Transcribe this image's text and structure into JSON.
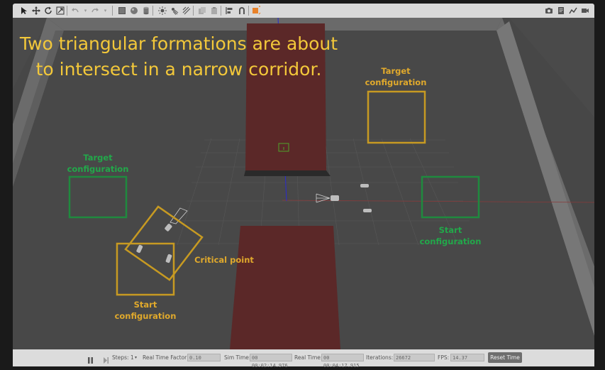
{
  "overlay": {
    "title_line1": "Two triangular formations are about",
    "title_line2": "to intersect in a narrow corridor."
  },
  "annotations": {
    "target_gold_1": "Target",
    "target_gold_2": "configuration",
    "target_green_1": "Target",
    "target_green_2": "configuration",
    "start_green_1": "Start",
    "start_green_2": "configuration",
    "start_gold_1": "Start",
    "start_gold_2": "configuration",
    "critical": "Critical point"
  },
  "colors": {
    "gold": "#e0a92c",
    "green": "#22a84a",
    "obstacle": "#5a2a2a",
    "ground": "#484848"
  },
  "toolbar": {
    "icons": [
      "select-arrow-icon",
      "translate-icon",
      "rotate-icon",
      "scale-icon",
      "undo-icon",
      "undo-dropdown-icon",
      "redo-icon",
      "redo-dropdown-icon",
      "box-icon",
      "sphere-icon",
      "cylinder-icon",
      "point-light-icon",
      "spot-light-icon",
      "directional-light-icon",
      "copy-icon",
      "paste-icon",
      "align-icon",
      "snap-icon",
      "view-angle-icon",
      "screenshot-icon",
      "log-icon",
      "plot-icon",
      "record-video-icon"
    ]
  },
  "statusbar": {
    "steps_label": "Steps:",
    "steps_value": "1",
    "rtf_label": "Real Time Factor:",
    "rtf_value": "0.10",
    "sim_time_label": "Sim Time:",
    "sim_time_value": "00 00:02:14.976",
    "real_time_label": "Real Time:",
    "real_time_value": "00 00:04:17.915",
    "iterations_label": "Iterations:",
    "iterations_value": "26672",
    "fps_label": "FPS:",
    "fps_value": "14.37",
    "reset_label": "Reset Time"
  }
}
